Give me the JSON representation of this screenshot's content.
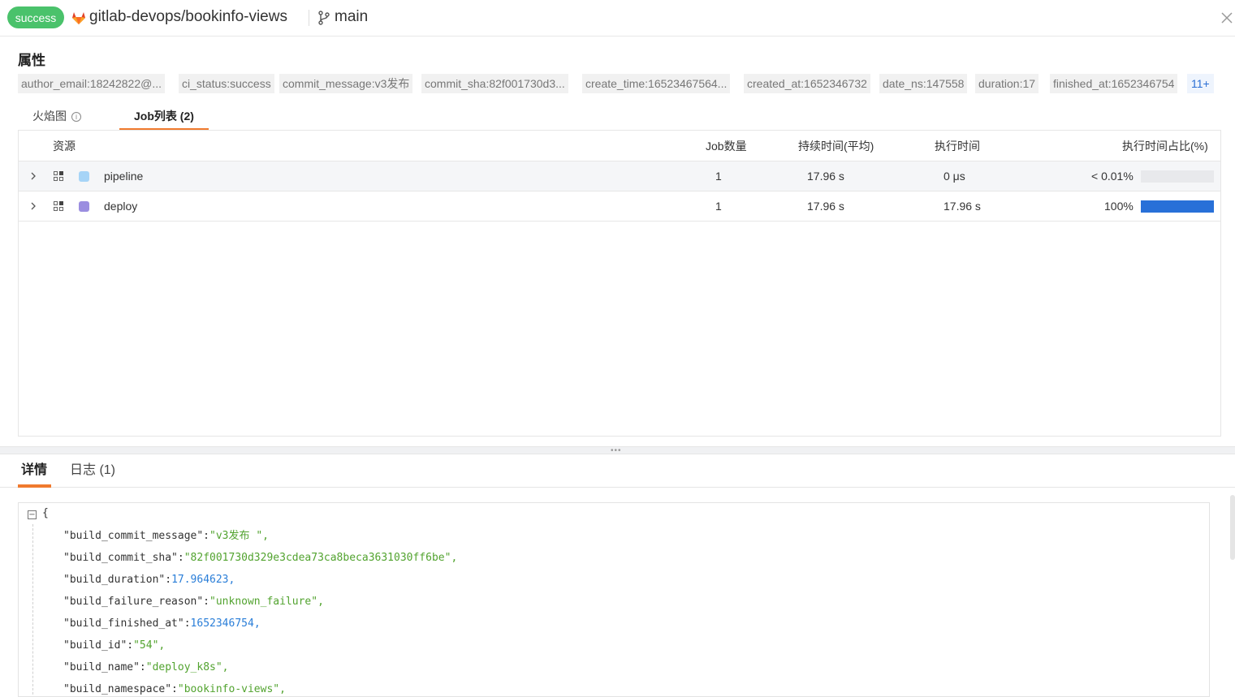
{
  "header": {
    "status": "success",
    "repo": "gitlab-devops/bookinfo-views",
    "branch": "main",
    "colors": {
      "status_bg": "#4ac26b",
      "accent": "#f07a2e",
      "gitlab": "#e24329"
    }
  },
  "properties": {
    "title": "属性",
    "tags": [
      "author_email:18242822@...",
      "ci_status:success",
      "commit_message:v3发布",
      "commit_sha:82f001730d3...",
      "create_time:16523467564...",
      "created_at:1652346732",
      "date_ns:147558",
      "duration:17",
      "finished_at:1652346754"
    ],
    "more": "11+"
  },
  "tabs_top": [
    {
      "label": "火焰图",
      "active": false
    },
    {
      "label": "Job列表 (2)",
      "active": true
    }
  ],
  "table": {
    "columns": [
      "资源",
      "Job数量",
      "持续时间(平均)",
      "执行时间",
      "执行时间占比(%)"
    ],
    "rows": [
      {
        "name": "pipeline",
        "count": "1",
        "duration": "17.96 s",
        "exec": "0 μs",
        "ratio_label": "< 0.01%",
        "ratio": 0.0001,
        "color": "#a6d4f7"
      },
      {
        "name": "deploy",
        "count": "1",
        "duration": "17.96 s",
        "exec": "17.96 s",
        "ratio_label": "100%",
        "ratio": 1.0,
        "color": "#9b8ee0"
      }
    ]
  },
  "tabs_bottom": [
    {
      "label": "详情",
      "active": true
    },
    {
      "label": "日志 (1)",
      "active": false
    }
  ],
  "json_view": {
    "open": "{",
    "lines": [
      {
        "key": "\"build_commit_message\"",
        "value": "\"v3发布 \"",
        "type": "s"
      },
      {
        "key": "\"build_commit_sha\"",
        "value": "\"82f001730d329e3cdea73ca8beca3631030ff6be\"",
        "type": "s"
      },
      {
        "key": "\"build_duration\"",
        "value": "17.964623",
        "type": "n"
      },
      {
        "key": "\"build_failure_reason\"",
        "value": "\"unknown_failure\"",
        "type": "s"
      },
      {
        "key": "\"build_finished_at\"",
        "value": "1652346754",
        "type": "n"
      },
      {
        "key": "\"build_id\"",
        "value": "\"54\"",
        "type": "s"
      },
      {
        "key": "\"build_name\"",
        "value": "\"deploy_k8s\"",
        "type": "s"
      },
      {
        "key": "\"build_namespace\"",
        "value": "\"bookinfo-views\"",
        "type": "s"
      }
    ]
  }
}
